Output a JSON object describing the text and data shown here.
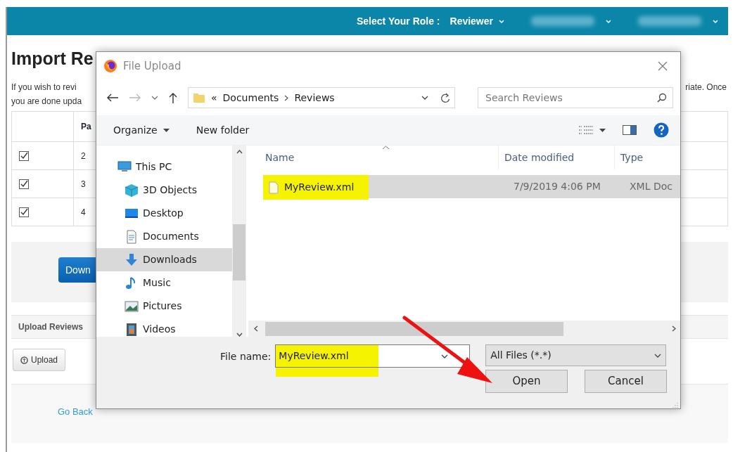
{
  "header": {
    "role_label": "Select Your Role :",
    "role": "Reviewer"
  },
  "page": {
    "title": "Import Re",
    "intro_left": [
      "If you wish to revi",
      "you are done upda"
    ],
    "intro_right": "riate. Once",
    "table": {
      "column_2": "Pa",
      "rows": [
        {
          "checked": true,
          "column_2": "2"
        },
        {
          "checked": true,
          "column_2": "3"
        },
        {
          "checked": true,
          "column_2": "4"
        }
      ]
    },
    "download_button": "Down",
    "upload_section": {
      "title": "Upload Reviews",
      "button": "Upload"
    },
    "back_link": "Go Back"
  },
  "dialog": {
    "title": "File Upload",
    "address": {
      "overflow": "«",
      "path": [
        "Documents",
        "Reviews"
      ]
    },
    "search": {
      "placeholder": "Search Reviews"
    },
    "toolbar": [
      "Organize",
      "New folder"
    ],
    "nav": [
      {
        "label": "This PC",
        "kind": "pc",
        "selected": false,
        "children": [
          {
            "label": "3D Objects",
            "kind": "cube",
            "selected": false
          },
          {
            "label": "Desktop",
            "kind": "desktop",
            "selected": false
          },
          {
            "label": "Documents",
            "kind": "documents",
            "selected": false
          },
          {
            "label": "Downloads",
            "kind": "downloads",
            "selected": true
          },
          {
            "label": "Music",
            "kind": "music",
            "selected": false
          },
          {
            "label": "Pictures",
            "kind": "pictures",
            "selected": false
          },
          {
            "label": "Videos",
            "kind": "videos",
            "selected": false
          }
        ]
      }
    ],
    "columns": [
      "Name",
      "Date modified",
      "Type"
    ],
    "files": [
      {
        "name": "MyReview.xml",
        "date": "7/9/2019 4:06 PM",
        "type": "XML Doc",
        "selected": true,
        "highlighted": true
      }
    ],
    "file_name_label": "File name:",
    "file_name": "MyReview.xml",
    "file_name_highlighted": true,
    "file_type": "All Files (*.*)",
    "buttons": [
      "Open",
      "Cancel"
    ]
  }
}
